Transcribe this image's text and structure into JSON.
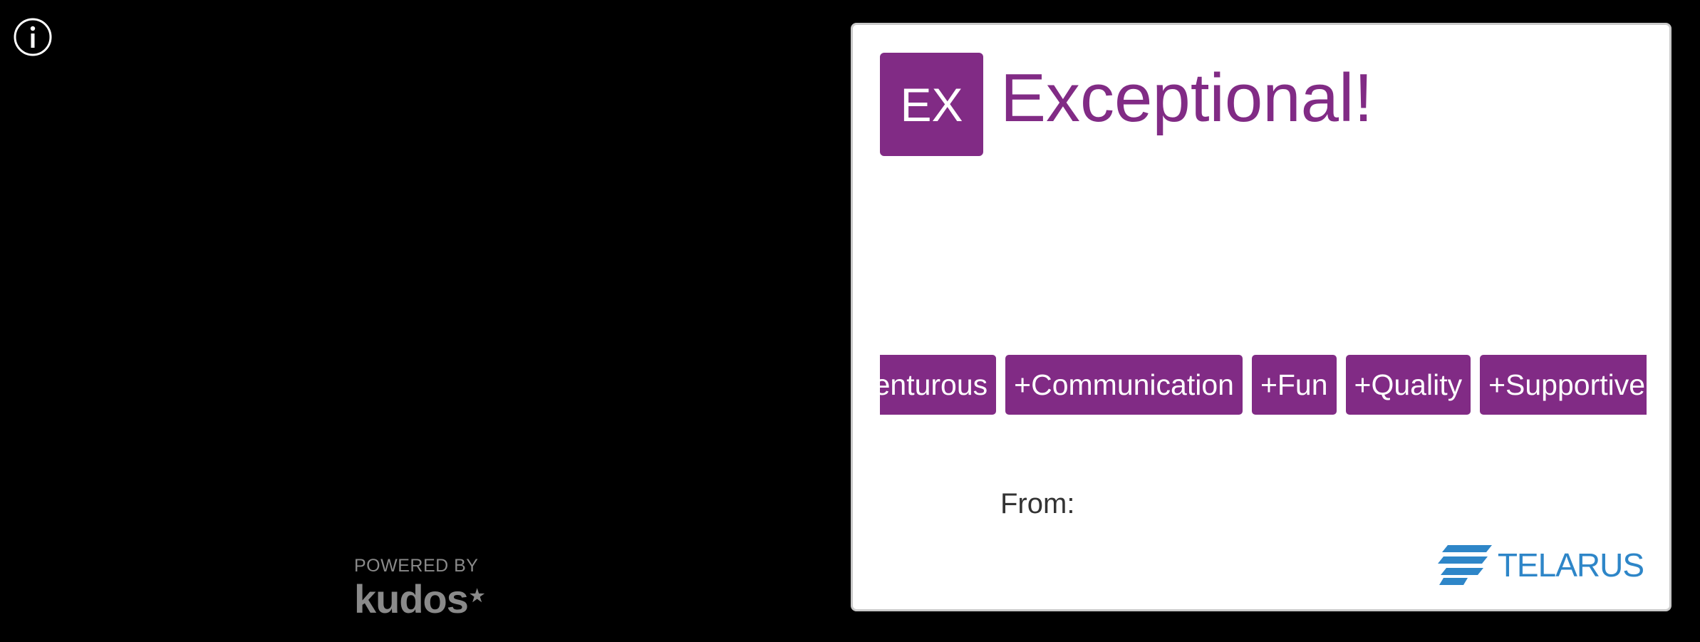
{
  "info": {
    "icon": "info-icon"
  },
  "powered_by": {
    "label": "POWERED BY",
    "brand": "kudos",
    "star": "★",
    "color": "#8a8a8a"
  },
  "card": {
    "badge_text": "EX",
    "title": "Exceptional!",
    "accent_color": "#812b85",
    "tags": [
      "+Adventurous",
      "+Communication",
      "+Fun",
      "+Quality",
      "+Supportive"
    ],
    "from_label": "From:",
    "from_value": "",
    "company_logo": {
      "name": "TELARUS",
      "icon": "telarus-wave-icon",
      "color": "#2e86c8"
    }
  }
}
